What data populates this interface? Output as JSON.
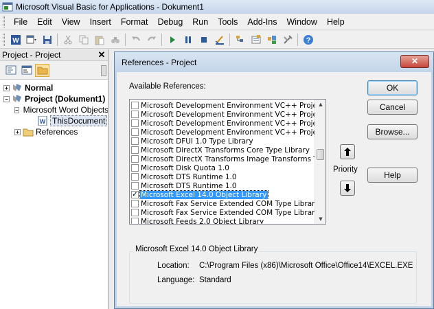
{
  "window": {
    "title": "Microsoft Visual Basic for Applications - Dokument1"
  },
  "menu": [
    "File",
    "Edit",
    "View",
    "Insert",
    "Format",
    "Debug",
    "Run",
    "Tools",
    "Add-Ins",
    "Window",
    "Help"
  ],
  "project_panel": {
    "title": "Project - Project",
    "close": "✕",
    "tree": {
      "normal": "Normal",
      "project": "Project (Dokument1)",
      "word_objects": "Microsoft Word Objects",
      "this_document": "ThisDocument",
      "references": "References"
    }
  },
  "dialog": {
    "title": "References - Project",
    "close": "✕",
    "available_label": "Available References:",
    "references": [
      {
        "label": "Microsoft Development Environment VC++ Project Sy",
        "checked": false
      },
      {
        "label": "Microsoft Development Environment VC++ Project Sy",
        "checked": false
      },
      {
        "label": "Microsoft Development Environment VC++ Project Sy",
        "checked": false
      },
      {
        "label": "Microsoft Development Environment VC++ Project Sy",
        "checked": false
      },
      {
        "label": "Microsoft DFUI 1.0 Type Library",
        "checked": false
      },
      {
        "label": "Microsoft DirectX Transforms Core Type Library",
        "checked": false
      },
      {
        "label": "Microsoft DirectX Transforms Image Transforms Type",
        "checked": false
      },
      {
        "label": "Microsoft Disk Quota 1.0",
        "checked": false
      },
      {
        "label": "Microsoft DTS Runtime 1.0",
        "checked": false
      },
      {
        "label": "Microsoft DTS Runtime 1.0",
        "checked": false
      },
      {
        "label": "Microsoft Excel 14.0 Object Library",
        "checked": true,
        "selected": true
      },
      {
        "label": "Microsoft Fax Service Extended COM Type Library",
        "checked": false
      },
      {
        "label": "Microsoft Fax Service Extended COM Type Library",
        "checked": false
      },
      {
        "label": "Microsoft Feeds 2.0 Object Library",
        "checked": false
      }
    ],
    "buttons": {
      "ok": "OK",
      "cancel": "Cancel",
      "browse": "Browse...",
      "help": "Help"
    },
    "priority_label": "Priority",
    "details": {
      "title": "Microsoft Excel 14.0 Object Library",
      "location_label": "Location:",
      "location_value": "C:\\Program Files (x86)\\Microsoft Office\\Office14\\EXCEL.EXE",
      "language_label": "Language:",
      "language_value": "Standard"
    }
  }
}
